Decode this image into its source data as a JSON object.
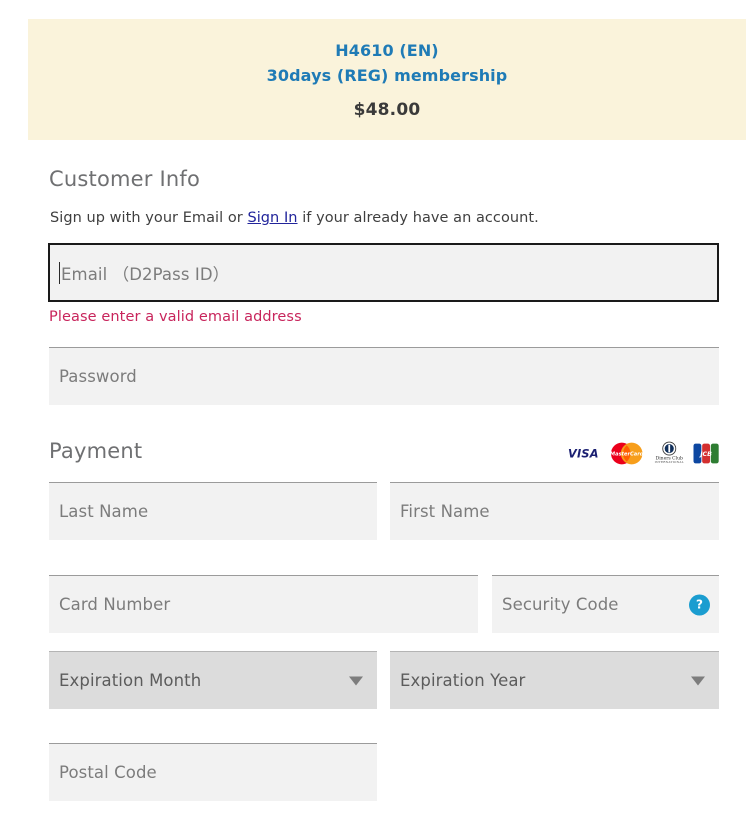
{
  "banner": {
    "product_code": "H4610 (EN)",
    "product_name": "30days (REG) membership",
    "price": "$48.00",
    "bg_color": "#faf3db",
    "title_color": "#1f7bb6"
  },
  "customer_info": {
    "heading": "Customer Info",
    "signup_text_before": "Sign up with your Email or ",
    "signin_link": "Sign In",
    "signup_text_after": " if your already have an account.",
    "email_placeholder": "Email （D2Pass ID）",
    "email_error": "Please enter a valid email address",
    "email_error_color": "#c8255c",
    "password_placeholder": "Password"
  },
  "payment": {
    "heading": "Payment",
    "accepted_cards": [
      "VISA",
      "MasterCard",
      "Diners Club International",
      "JCB"
    ],
    "last_name_placeholder": "Last Name",
    "first_name_placeholder": "First Name",
    "card_number_placeholder": "Card Number",
    "security_code_placeholder": "Security Code",
    "security_code_help": "?",
    "security_code_help_color": "#1b9dd0",
    "expiration_month_placeholder": "Expiration Month",
    "expiration_year_placeholder": "Expiration Year",
    "postal_code_placeholder": "Postal Code"
  }
}
